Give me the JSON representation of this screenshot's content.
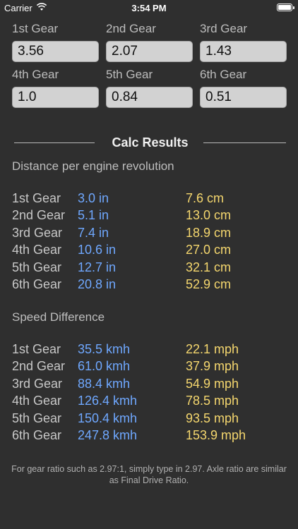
{
  "status": {
    "carrier": "Carrier",
    "time": "3:54 PM"
  },
  "gears": [
    {
      "label": "1st Gear",
      "value": "3.56"
    },
    {
      "label": "2nd Gear",
      "value": "2.07"
    },
    {
      "label": "3rd Gear",
      "value": "1.43"
    },
    {
      "label": "4th Gear",
      "value": "1.0"
    },
    {
      "label": "5th Gear",
      "value": "0.84"
    },
    {
      "label": "6th Gear",
      "value": "0.51"
    }
  ],
  "results": {
    "title": "Calc Results",
    "distance": {
      "heading": "Distance per engine revolution",
      "rows": [
        {
          "gear": "1st Gear",
          "imperial": "3.0 in",
          "metric": "7.6 cm"
        },
        {
          "gear": "2nd Gear",
          "imperial": "5.1 in",
          "metric": "13.0 cm"
        },
        {
          "gear": "3rd Gear",
          "imperial": "7.4 in",
          "metric": "18.9 cm"
        },
        {
          "gear": "4th Gear",
          "imperial": "10.6 in",
          "metric": "27.0 cm"
        },
        {
          "gear": "5th Gear",
          "imperial": "12.7 in",
          "metric": "32.1 cm"
        },
        {
          "gear": "6th Gear",
          "imperial": "20.8 in",
          "metric": "52.9 cm"
        }
      ]
    },
    "speed": {
      "heading": "Speed Difference",
      "rows": [
        {
          "gear": "1st Gear",
          "kmh": "35.5 kmh",
          "mph": "22.1 mph"
        },
        {
          "gear": "2nd Gear",
          "kmh": "61.0 kmh",
          "mph": "37.9 mph"
        },
        {
          "gear": "3rd Gear",
          "kmh": "88.4 kmh",
          "mph": "54.9 mph"
        },
        {
          "gear": "4th Gear",
          "kmh": "126.4 kmh",
          "mph": "78.5 mph"
        },
        {
          "gear": "5th Gear",
          "kmh": "150.4 kmh",
          "mph": "93.5 mph"
        },
        {
          "gear": "6th Gear",
          "kmh": "247.8 kmh",
          "mph": "153.9 mph"
        }
      ]
    }
  },
  "footnote": "For gear ratio such as 2.97:1, simply type in 2.97. Axle ratio are similar as Final Drive Ratio.",
  "colors": {
    "background": "#2f2f2f",
    "blue_value": "#6fa8ff",
    "yellow_value": "#f5d76e"
  }
}
